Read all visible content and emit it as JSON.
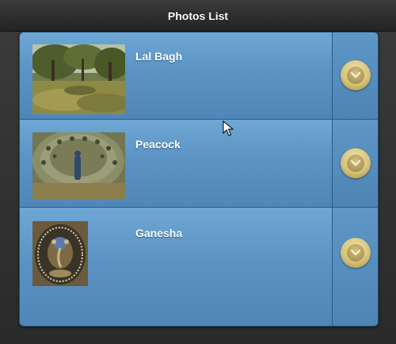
{
  "header": {
    "title": "Photos List"
  },
  "list": {
    "items": [
      {
        "title": "Lal Bagh",
        "thumb_icon": "garden-photo",
        "action_icon": "chevron-down-icon"
      },
      {
        "title": "Peacock",
        "thumb_icon": "peacock-photo",
        "action_icon": "chevron-down-icon"
      },
      {
        "title": "Ganesha",
        "thumb_icon": "ganesha-photo",
        "action_icon": "chevron-down-icon"
      }
    ]
  },
  "colors": {
    "header_bg": "#2a2a2a",
    "row_bg": "#5a93c4",
    "split_button": "#d8c37a"
  }
}
